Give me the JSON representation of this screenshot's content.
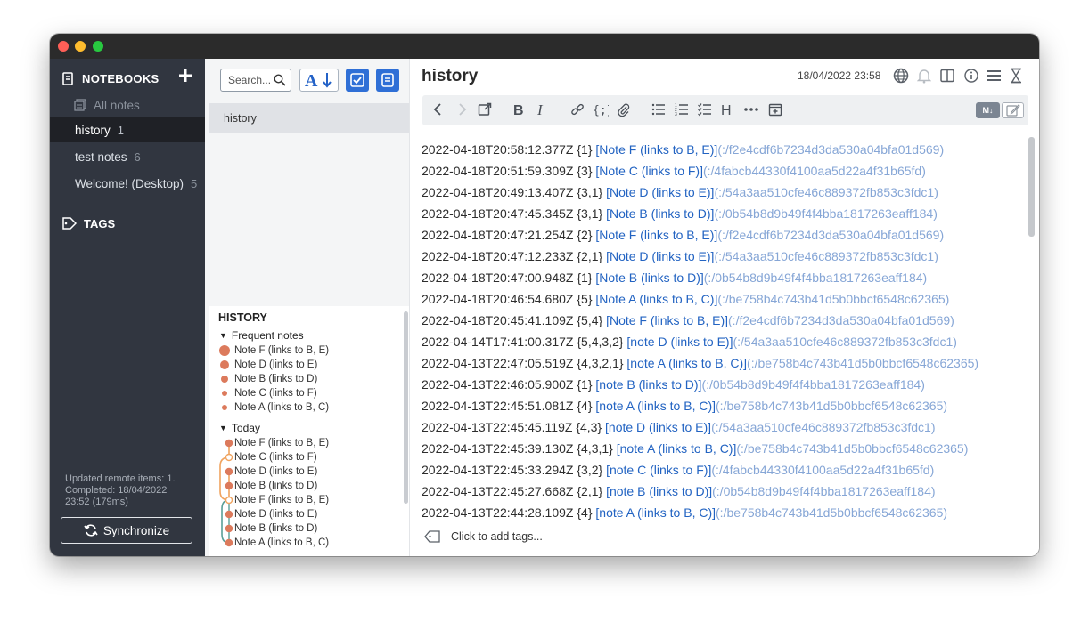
{
  "app": {
    "window_title": ""
  },
  "sidebar": {
    "notebooks_header": "NOTEBOOKS",
    "all_notes": "All notes",
    "notebooks": [
      {
        "label": "history",
        "count": "1",
        "selected": true
      },
      {
        "label": "test notes",
        "count": "6",
        "selected": false
      },
      {
        "label": "Welcome! (Desktop)",
        "count": "5",
        "selected": false
      }
    ],
    "tags_header": "TAGS",
    "status_line1": "Updated remote items: 1.",
    "status_line2": "Completed: 18/04/2022",
    "status_line3": "23:52 (179ms)",
    "sync_label": "Synchronize"
  },
  "notelist": {
    "search_placeholder": "Search...",
    "notes": [
      {
        "title": "history"
      }
    ],
    "history": {
      "title": "HISTORY",
      "frequent_label": "Frequent notes",
      "frequent": [
        {
          "label": "Note F (links to B, E)",
          "weight": 5
        },
        {
          "label": "Note D (links to E)",
          "weight": 4
        },
        {
          "label": "Note B (links to D)",
          "weight": 3
        },
        {
          "label": "Note C (links to F)",
          "weight": 2
        },
        {
          "label": "Note A (links to B, C)",
          "weight": 2
        }
      ],
      "today_label": "Today",
      "today": [
        "Note F (links to B, E)",
        "Note C (links to F)",
        "Note D (links to E)",
        "Note B (links to D)",
        "Note F (links to B, E)",
        "Note D (links to E)",
        "Note B (links to D)",
        "Note A (links to B, C)"
      ]
    }
  },
  "editor": {
    "title": "history",
    "datetime": "18/04/2022 23:58",
    "md_label": "M↓",
    "tags_placeholder": "Click to add tags...",
    "lines": [
      {
        "ts": "2022-04-18T20:58:12.377Z",
        "ids": "{1}",
        "link": "[Note F (links to B, E)]",
        "url": "(:/f2e4cdf6b7234d3da530a04bfa01d569)"
      },
      {
        "ts": "2022-04-18T20:51:59.309Z",
        "ids": "{3}",
        "link": "[Note C (links to F)]",
        "url": "(:/4fabcb44330f4100aa5d22a4f31b65fd)"
      },
      {
        "ts": "2022-04-18T20:49:13.407Z",
        "ids": "{3,1}",
        "link": "[Note D (links to E)]",
        "url": "(:/54a3aa510cfe46c889372fb853c3fdc1)"
      },
      {
        "ts": "2022-04-18T20:47:45.345Z",
        "ids": "{3,1}",
        "link": "[Note B (links to D)]",
        "url": "(:/0b54b8d9b49f4f4bba1817263eaff184)"
      },
      {
        "ts": "2022-04-18T20:47:21.254Z",
        "ids": "{2}",
        "link": "[Note F (links to B, E)]",
        "url": "(:/f2e4cdf6b7234d3da530a04bfa01d569)"
      },
      {
        "ts": "2022-04-18T20:47:12.233Z",
        "ids": "{2,1}",
        "link": "[Note D (links to E)]",
        "url": "(:/54a3aa510cfe46c889372fb853c3fdc1)"
      },
      {
        "ts": "2022-04-18T20:47:00.948Z",
        "ids": "{1}",
        "link": "[Note B (links to D)]",
        "url": "(:/0b54b8d9b49f4f4bba1817263eaff184)"
      },
      {
        "ts": "2022-04-18T20:46:54.680Z",
        "ids": "{5}",
        "link": "[Note A (links to B, C)]",
        "url": "(:/be758b4c743b41d5b0bbcf6548c62365)"
      },
      {
        "ts": "2022-04-18T20:45:41.109Z",
        "ids": "{5,4}",
        "link": "[Note F (links to B, E)]",
        "url": "(:/f2e4cdf6b7234d3da530a04bfa01d569)"
      },
      {
        "ts": "2022-04-14T17:41:00.317Z",
        "ids": "{5,4,3,2}",
        "link": "[note D (links to E)]",
        "url": "(:/54a3aa510cfe46c889372fb853c3fdc1)"
      },
      {
        "ts": "2022-04-13T22:47:05.519Z",
        "ids": "{4,3,2,1}",
        "link": "[note A (links to B, C)]",
        "url": "(:/be758b4c743b41d5b0bbcf6548c62365)"
      },
      {
        "ts": "2022-04-13T22:46:05.900Z",
        "ids": "{1}",
        "link": "[note B (links to D)]",
        "url": "(:/0b54b8d9b49f4f4bba1817263eaff184)"
      },
      {
        "ts": "2022-04-13T22:45:51.081Z",
        "ids": "{4}",
        "link": "[note A (links to B, C)]",
        "url": "(:/be758b4c743b41d5b0bbcf6548c62365)"
      },
      {
        "ts": "2022-04-13T22:45:45.119Z",
        "ids": "{4,3}",
        "link": "[note D (links to E)]",
        "url": "(:/54a3aa510cfe46c889372fb853c3fdc1)"
      },
      {
        "ts": "2022-04-13T22:45:39.130Z",
        "ids": "{4,3,1}",
        "link": "[note A (links to B, C)]",
        "url": "(:/be758b4c743b41d5b0bbcf6548c62365)"
      },
      {
        "ts": "2022-04-13T22:45:33.294Z",
        "ids": "{3,2}",
        "link": "[note C (links to F)]",
        "url": "(:/4fabcb44330f4100aa5d22a4f31b65fd)"
      },
      {
        "ts": "2022-04-13T22:45:27.668Z",
        "ids": "{2,1}",
        "link": "[note B (links to D)]",
        "url": "(:/0b54b8d9b49f4f4bba1817263eaff184)"
      },
      {
        "ts": "2022-04-13T22:44:28.109Z",
        "ids": "{4}",
        "link": "[note A (links to B, C)]",
        "url": "(:/be758b4c743b41d5b0bbcf6548c62365)"
      }
    ]
  },
  "colors": {
    "accent": "#2f6fd6",
    "link": "#2263c2",
    "link_url": "#86a6d6",
    "sidebar_bg": "#313640",
    "history_dot": "#dc7a5c",
    "graph_orange": "#f0a35e",
    "graph_teal": "#5a9f97"
  }
}
